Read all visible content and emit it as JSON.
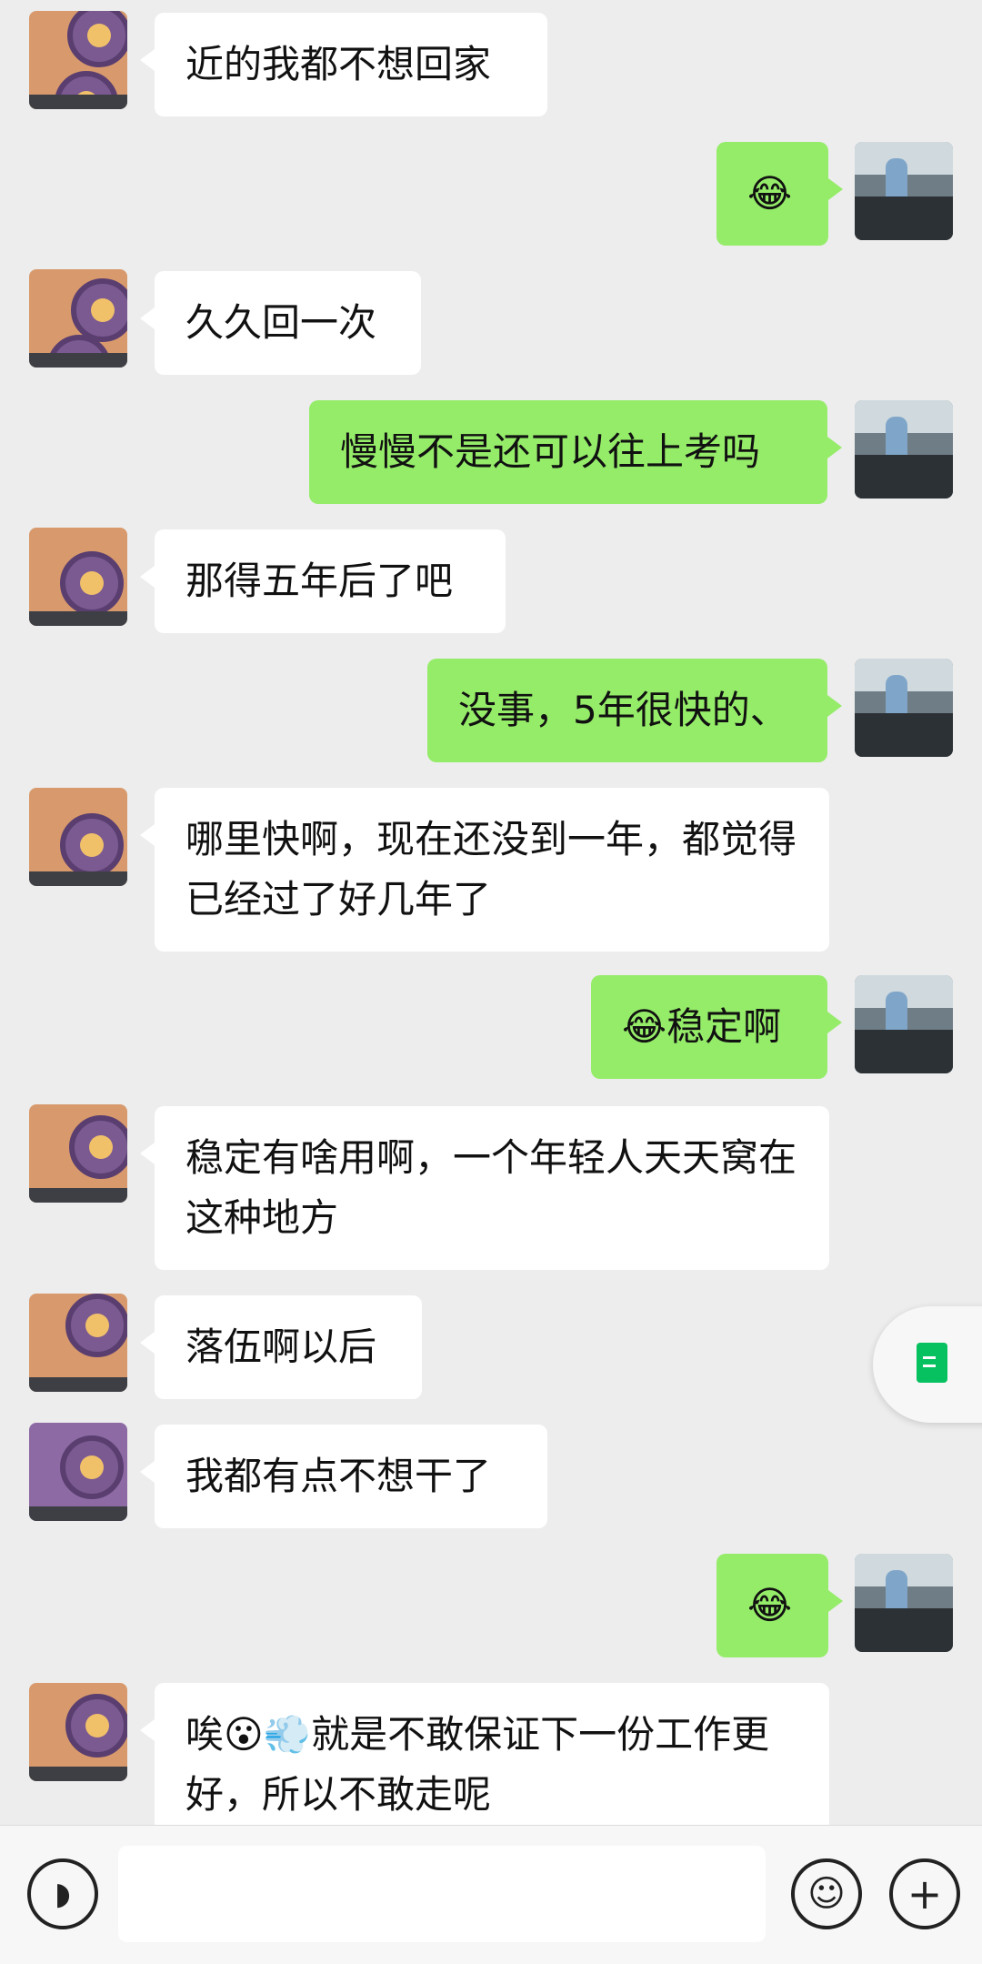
{
  "messages": [
    {
      "side": "left",
      "text": "近的我都不想回家"
    },
    {
      "side": "right",
      "text": "😂"
    },
    {
      "side": "left",
      "text": "久久回一次"
    },
    {
      "side": "right",
      "text": "慢慢不是还可以往上考吗"
    },
    {
      "side": "left",
      "text": "那得五年后了吧"
    },
    {
      "side": "right",
      "text": "没事，5年很快的、"
    },
    {
      "side": "left",
      "text": "哪里快啊，现在还没到一年，都觉得已经过了好几年了"
    },
    {
      "side": "right",
      "text": "😂稳定啊"
    },
    {
      "side": "left",
      "text": "稳定有啥用啊，一个年轻人天天窝在这种地方"
    },
    {
      "side": "left",
      "text": "落伍啊以后"
    },
    {
      "side": "left",
      "text": "我都有点不想干了"
    },
    {
      "side": "right",
      "text": "😂"
    },
    {
      "side": "left",
      "text": "唉😮💨就是不敢保证下一份工作更好，所以不敢走呢"
    }
  ],
  "icons": {
    "voice": "voice-icon",
    "emoji": "emoji-icon",
    "plus": "plus-icon",
    "floating_doc": "document-icon"
  },
  "colors": {
    "background": "#ededed",
    "sent_bubble": "#95ec69",
    "received_bubble": "#ffffff"
  }
}
